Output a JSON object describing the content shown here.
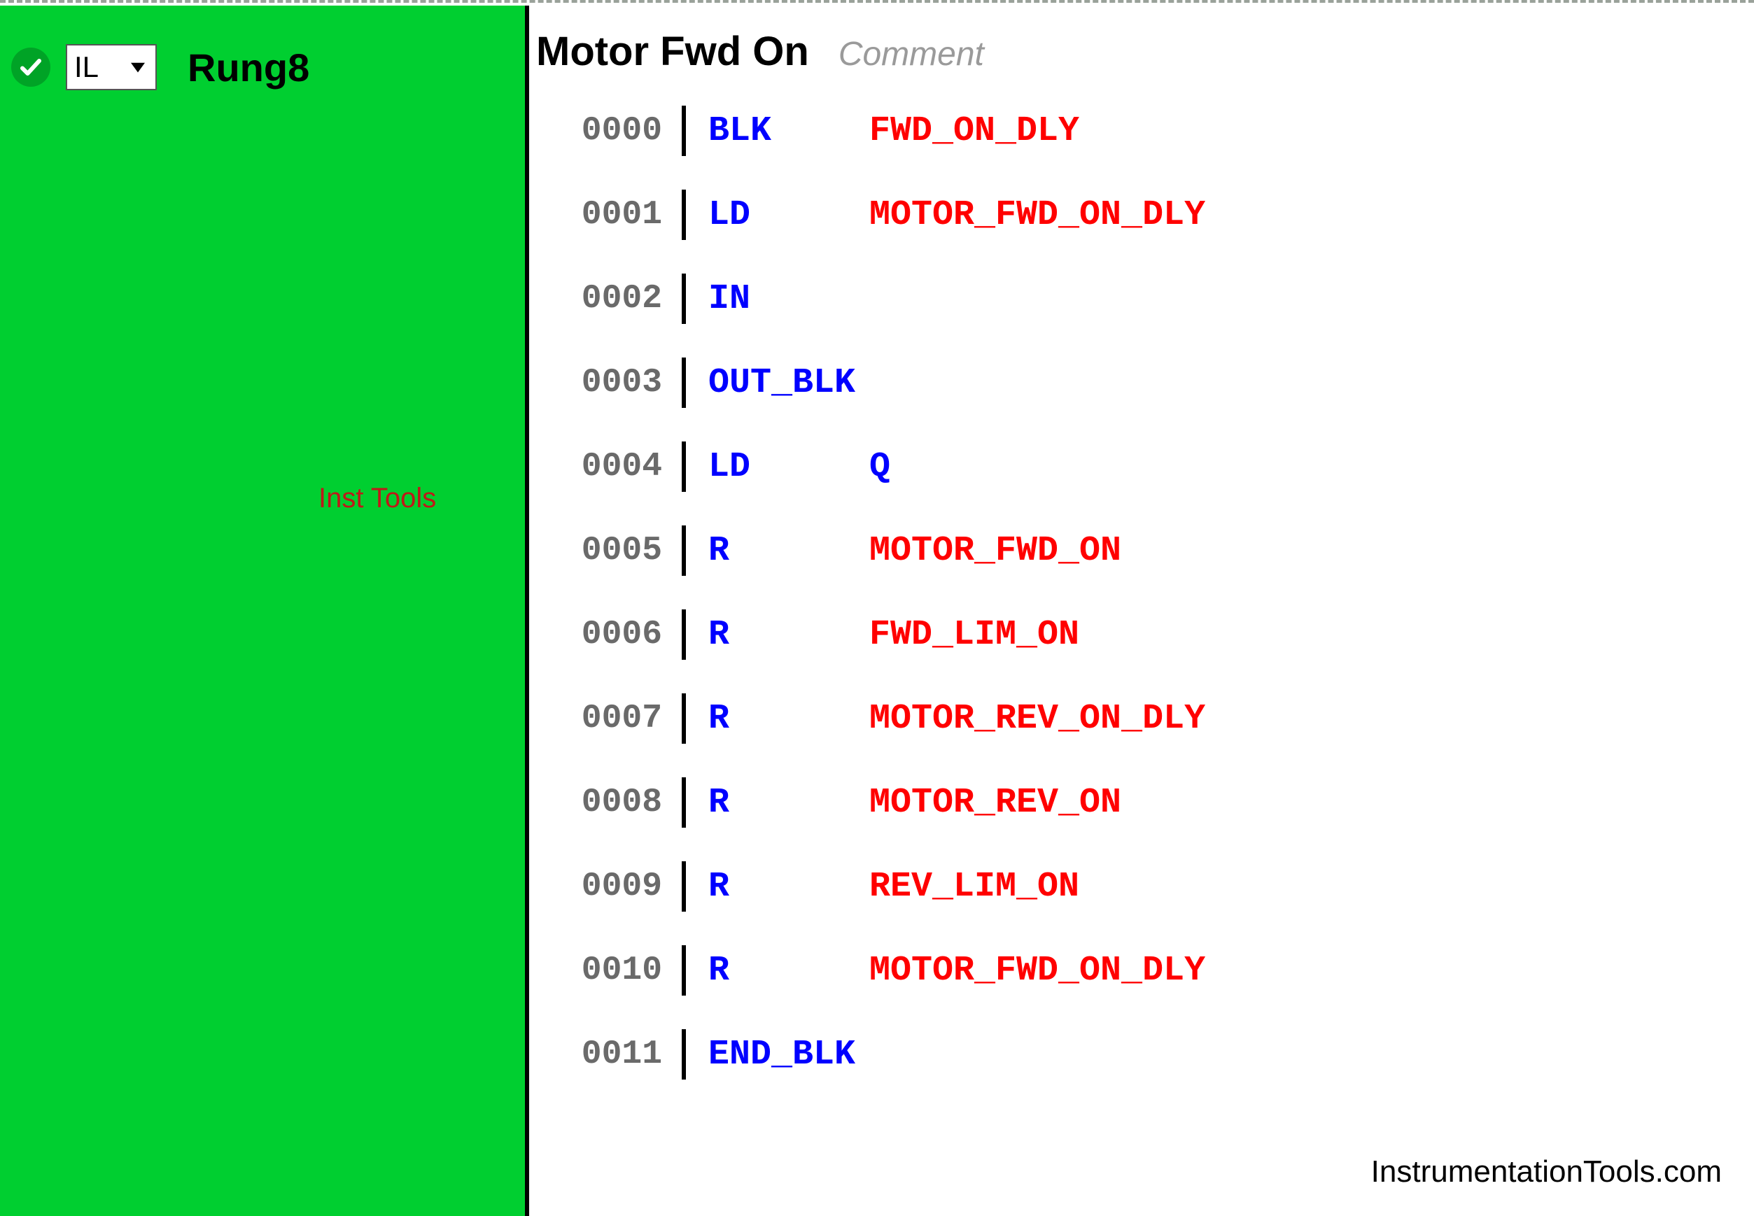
{
  "sidebar": {
    "language": "IL",
    "rung_label": "Rung8",
    "watermark": "Inst Tools",
    "status_icon": "check-icon"
  },
  "header": {
    "title": "Motor Fwd On",
    "comment_placeholder": "Comment"
  },
  "code": [
    {
      "addr": "0000",
      "op": "BLK",
      "arg": "FWD_ON_DLY",
      "arg_color": "red"
    },
    {
      "addr": "0001",
      "op": "LD",
      "arg": "MOTOR_FWD_ON_DLY",
      "arg_color": "red"
    },
    {
      "addr": "0002",
      "op": "IN",
      "arg": "",
      "arg_color": ""
    },
    {
      "addr": "0003",
      "op": "OUT_BLK",
      "arg": "",
      "arg_color": ""
    },
    {
      "addr": "0004",
      "op": "LD",
      "arg": "Q",
      "arg_color": "blue"
    },
    {
      "addr": "0005",
      "op": "R",
      "arg": "MOTOR_FWD_ON",
      "arg_color": "red"
    },
    {
      "addr": "0006",
      "op": "R",
      "arg": "FWD_LIM_ON",
      "arg_color": "red"
    },
    {
      "addr": "0007",
      "op": "R",
      "arg": "MOTOR_REV_ON_DLY",
      "arg_color": "red"
    },
    {
      "addr": "0008",
      "op": "R",
      "arg": "MOTOR_REV_ON",
      "arg_color": "red"
    },
    {
      "addr": "0009",
      "op": "R",
      "arg": "REV_LIM_ON",
      "arg_color": "red"
    },
    {
      "addr": "0010",
      "op": "R",
      "arg": "MOTOR_FWD_ON_DLY",
      "arg_color": "red"
    },
    {
      "addr": "0011",
      "op": "END_BLK",
      "arg": "",
      "arg_color": ""
    }
  ],
  "footer": {
    "site": "InstrumentationTools.com"
  }
}
